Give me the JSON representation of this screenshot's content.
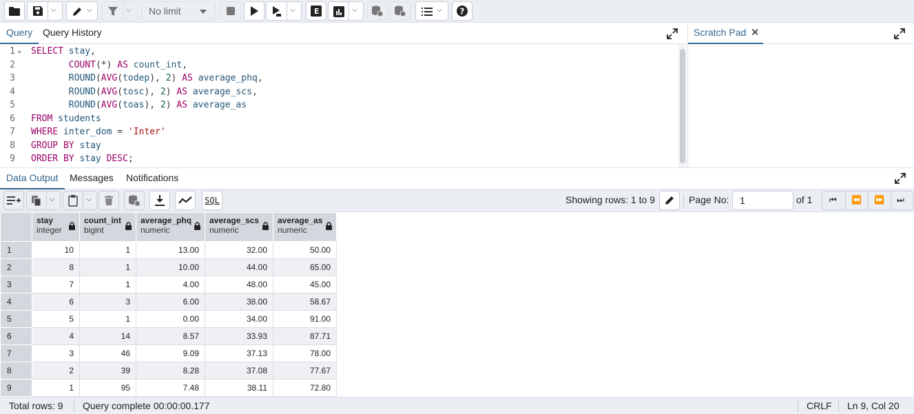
{
  "toolbar": {
    "limit_label": "No limit"
  },
  "editor_tabs": {
    "query": "Query",
    "history": "Query History",
    "scratch": "Scratch Pad"
  },
  "editor": {
    "line_numbers": [
      "1",
      "2",
      "3",
      "4",
      "5",
      "6",
      "7",
      "8",
      "9"
    ]
  },
  "results_tabs": {
    "data_output": "Data Output",
    "messages": "Messages",
    "notifications": "Notifications"
  },
  "results_toolbar": {
    "sql_label": "SQL",
    "showing_rows": "Showing rows: 1 to 9",
    "page_no_label": "Page No:",
    "page_no_value": "1",
    "of_pages": "of 1"
  },
  "grid": {
    "columns": [
      {
        "name": "stay",
        "type": "integer"
      },
      {
        "name": "count_int",
        "type": "bigint"
      },
      {
        "name": "average_phq",
        "type": "numeric"
      },
      {
        "name": "average_scs",
        "type": "numeric"
      },
      {
        "name": "average_as",
        "type": "numeric"
      }
    ],
    "rows": [
      {
        "n": "1",
        "cells": [
          "10",
          "1",
          "13.00",
          "32.00",
          "50.00"
        ]
      },
      {
        "n": "2",
        "cells": [
          "8",
          "1",
          "10.00",
          "44.00",
          "65.00"
        ]
      },
      {
        "n": "3",
        "cells": [
          "7",
          "1",
          "4.00",
          "48.00",
          "45.00"
        ]
      },
      {
        "n": "4",
        "cells": [
          "6",
          "3",
          "6.00",
          "38.00",
          "58.67"
        ]
      },
      {
        "n": "5",
        "cells": [
          "5",
          "1",
          "0.00",
          "34.00",
          "91.00"
        ]
      },
      {
        "n": "6",
        "cells": [
          "4",
          "14",
          "8.57",
          "33.93",
          "87.71"
        ]
      },
      {
        "n": "7",
        "cells": [
          "3",
          "46",
          "9.09",
          "37.13",
          "78.00"
        ]
      },
      {
        "n": "8",
        "cells": [
          "2",
          "39",
          "8.28",
          "37.08",
          "77.67"
        ]
      },
      {
        "n": "9",
        "cells": [
          "1",
          "95",
          "7.48",
          "38.11",
          "72.80"
        ]
      }
    ]
  },
  "status": {
    "total_rows": "Total rows: 9",
    "query_complete": "Query complete 00:00:00.177",
    "line_ending": "CRLF",
    "cursor_pos": "Ln 9, Col 20"
  },
  "colors": {
    "accent": "#326690",
    "keyword": "#990066",
    "identifier": "#225577",
    "number": "#116644",
    "string": "#aa1111"
  }
}
